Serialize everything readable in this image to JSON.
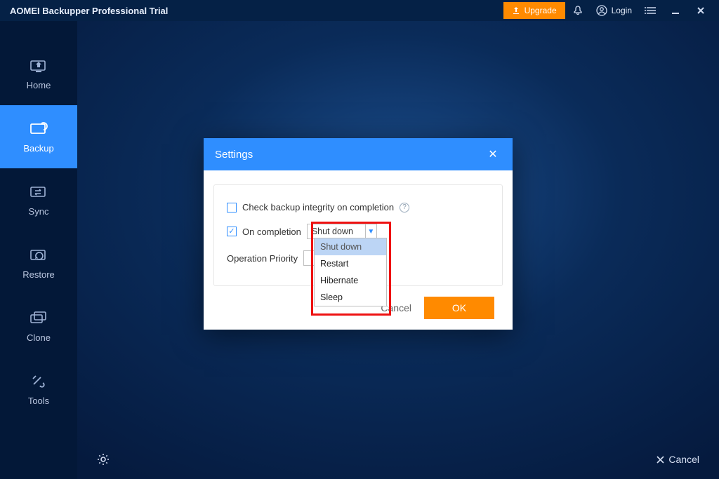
{
  "titlebar": {
    "title": "AOMEI Backupper Professional Trial",
    "upgrade": "Upgrade",
    "login": "Login"
  },
  "sidebar": {
    "items": [
      {
        "label": "Home"
      },
      {
        "label": "Backup"
      },
      {
        "label": "Sync"
      },
      {
        "label": "Restore"
      },
      {
        "label": "Clone"
      },
      {
        "label": "Tools"
      }
    ]
  },
  "bottom": {
    "cancel": "Cancel"
  },
  "modal": {
    "title": "Settings",
    "check_integrity_label": "Check backup integrity on completion",
    "on_completion_label": "On completion",
    "on_completion_value": "Shut down",
    "operation_priority_label": "Operation Priority",
    "options": [
      "Shut down",
      "Restart",
      "Hibernate",
      "Sleep"
    ],
    "cancel": "Cancel",
    "ok": "OK"
  }
}
